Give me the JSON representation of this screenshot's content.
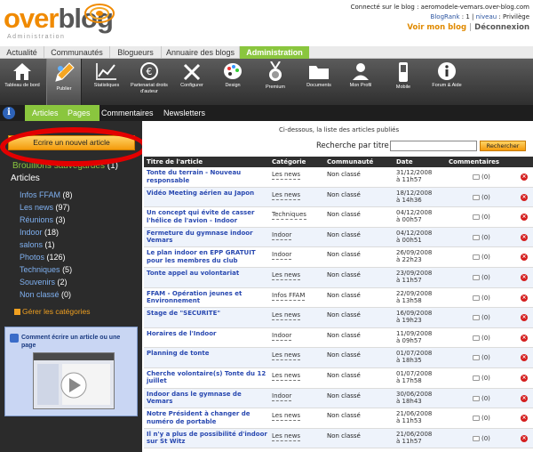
{
  "header": {
    "logo_over": "over",
    "logo_blog": "blog",
    "logo_sub": "Administration",
    "connected_text": "Connecté sur le blog : aeromodele-vemars.over-blog.com",
    "blogrank_label": "BlogRank",
    "blogrank_value": "1",
    "level_label": "niveau",
    "level_value": "Privilège",
    "my_blog": "Voir mon blog",
    "logout": "Déconnexion"
  },
  "nav_tabs": [
    "Actualité",
    "Communautés",
    "Blogueurs",
    "Annuaire des blogs",
    "Administration"
  ],
  "tools": [
    {
      "label": "Tableau de bord",
      "icon": "home-icon"
    },
    {
      "label": "Publier",
      "icon": "pencil-icon"
    },
    {
      "label": "Statistiques",
      "icon": "chart-icon"
    },
    {
      "label": "Partenariat droits d'auteur",
      "icon": "euro-icon"
    },
    {
      "label": "Configurer",
      "icon": "tools-icon"
    },
    {
      "label": "Design",
      "icon": "palette-icon"
    },
    {
      "label": "Premium",
      "icon": "medal-icon"
    },
    {
      "label": "Documents",
      "icon": "folder-icon"
    },
    {
      "label": "Mon Profil",
      "icon": "profile-icon"
    },
    {
      "label": "Mobile",
      "icon": "mobile-icon"
    },
    {
      "label": "Forum & Aide",
      "icon": "info-icon"
    }
  ],
  "subnav": {
    "info": "i",
    "tabs": [
      "Articles",
      "Pages",
      "Commentaires",
      "Newsletters"
    ]
  },
  "sidebar": {
    "write_button": "Ecrire un nouvel article",
    "drafts_label": "Brouillons sauvegardés",
    "drafts_count": "(1)",
    "articles_label": "Articles",
    "categories": [
      {
        "name": "Infos FFAM",
        "count": "(8)"
      },
      {
        "name": "Les news",
        "count": "(97)"
      },
      {
        "name": "Réunions",
        "count": "(3)"
      },
      {
        "name": "Indoor",
        "count": "(18)"
      },
      {
        "name": "salons",
        "count": "(1)"
      },
      {
        "name": "Photos",
        "count": "(126)"
      },
      {
        "name": "Techniques",
        "count": "(5)"
      },
      {
        "name": "Souvenirs",
        "count": "(2)"
      },
      {
        "name": "Non classé",
        "count": "(0)"
      }
    ],
    "manage_categories": "Gérer les catégories",
    "help_title": "Comment écrire un article ou une page"
  },
  "main": {
    "intro": "Ci-dessous, la liste des articles publiés",
    "search_label": "Recherche par titre :",
    "search_value": "",
    "search_button": "Rechercher",
    "columns": [
      "Titre de l'article",
      "Catégorie",
      "Communauté",
      "Date",
      "Commentaires"
    ],
    "rows": [
      {
        "title": "Tonte du terrain - Nouveau responsable",
        "category": "Les news",
        "community": "Non classé",
        "date": "31/12/2008",
        "time": "à 11h57",
        "comments": "(0)"
      },
      {
        "title": "Vidéo Meeting aérien au Japon",
        "category": "Les news",
        "community": "Non classé",
        "date": "18/12/2008",
        "time": "à 14h36",
        "comments": "(0)"
      },
      {
        "title": "Un concept qui évite de casser l'hélice de l'avion - Indoor",
        "category": "Techniques",
        "community": "Non classé",
        "date": "04/12/2008",
        "time": "à 00h57",
        "comments": "(0)"
      },
      {
        "title": "Fermeture du gymnase indoor Vemars",
        "category": "Indoor",
        "community": "Non classé",
        "date": "04/12/2008",
        "time": "à 00h51",
        "comments": "(0)"
      },
      {
        "title": "Le plan indoor en EPP GRATUIT pour les membres du club",
        "category": "Indoor",
        "community": "Non classé",
        "date": "26/09/2008",
        "time": "à 22h23",
        "comments": "(0)"
      },
      {
        "title": "Tonte appel au volontariat",
        "category": "Les news",
        "community": "Non classé",
        "date": "23/09/2008",
        "time": "à 11h57",
        "comments": "(0)"
      },
      {
        "title": "FFAM - Opération jeunes et Environnement",
        "category": "Infos FFAM",
        "community": "Non classé",
        "date": "22/09/2008",
        "time": "à 13h58",
        "comments": "(0)"
      },
      {
        "title": "Stage de \"SECURITE\"",
        "category": "Les news",
        "community": "Non classé",
        "date": "16/09/2008",
        "time": "à 19h23",
        "comments": "(0)"
      },
      {
        "title": "Horaires de l'Indoor",
        "category": "Indoor",
        "community": "Non classé",
        "date": "11/09/2008",
        "time": "à 09h57",
        "comments": "(0)"
      },
      {
        "title": "Planning de tonte",
        "category": "Les news",
        "community": "Non classé",
        "date": "01/07/2008",
        "time": "à 18h35",
        "comments": "(0)"
      },
      {
        "title": "Cherche volontaire(s) Tonte du 12 juillet",
        "category": "Les news",
        "community": "Non classé",
        "date": "01/07/2008",
        "time": "à 17h58",
        "comments": "(0)"
      },
      {
        "title": "Indoor dans le gymnase de Vemars",
        "category": "Indoor",
        "community": "Non classé",
        "date": "30/06/2008",
        "time": "à 18h43",
        "comments": "(0)"
      },
      {
        "title": "Notre Président à changer de numéro de portable",
        "category": "Les news",
        "community": "Non classé",
        "date": "21/06/2008",
        "time": "à 11h53",
        "comments": "(0)"
      },
      {
        "title": "Il n'y a plus de possibilité d'indoor sur St Witz",
        "category": "Les news",
        "community": "Non classé",
        "date": "21/06/2008",
        "time": "à 11h57",
        "comments": "(0)"
      }
    ]
  },
  "colors": {
    "green": "#8ac63e",
    "orange": "#f49b0c",
    "dark": "#2b2b2b",
    "link": "#2848b0",
    "red": "#e30000"
  }
}
